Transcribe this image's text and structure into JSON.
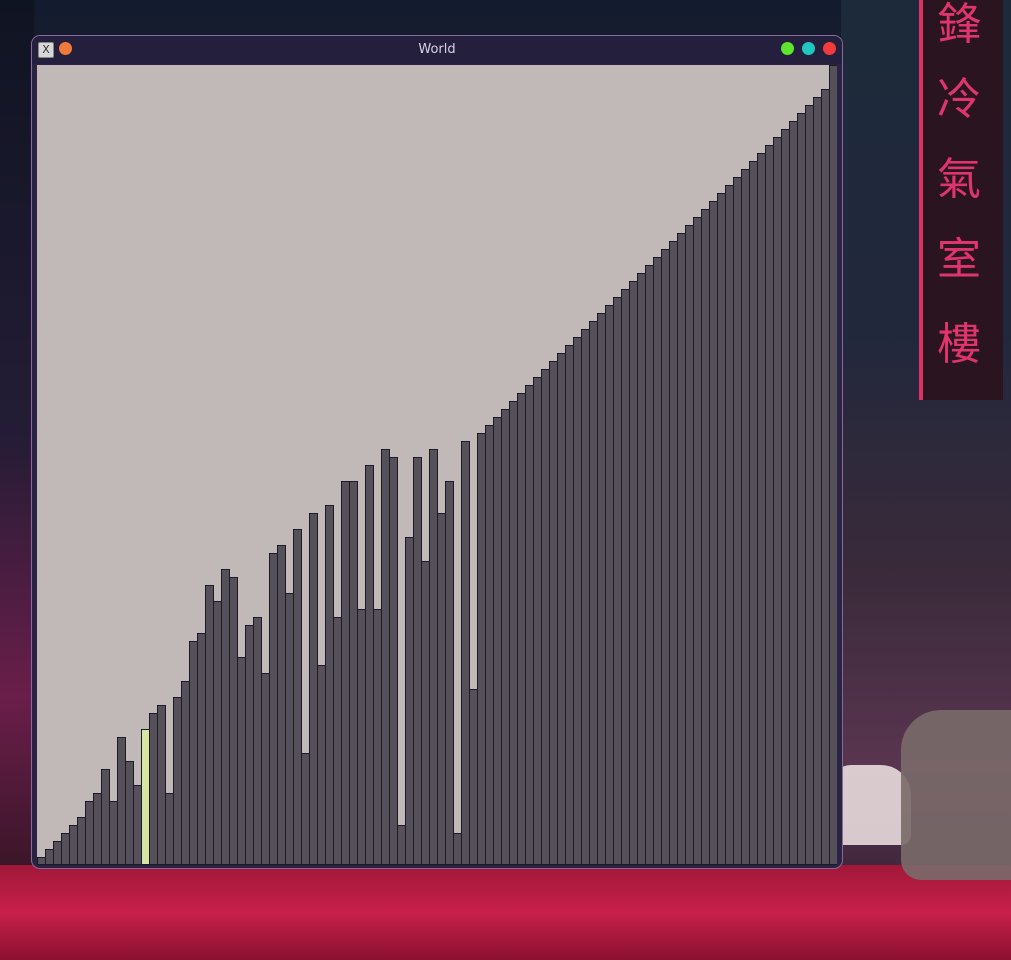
{
  "window": {
    "title": "World",
    "app_icon_glyph": "X"
  },
  "desktop": {
    "sign_glyphs": [
      "鋒",
      "冷",
      "氣",
      "室",
      "樓"
    ]
  },
  "colors": {
    "bar_fill": "#55505a",
    "bar_highlight": "#d7e5a4",
    "bar_border": "#1c1a22",
    "canvas_background": "#c1b9b8"
  },
  "visualization": {
    "type": "sorting-bars",
    "bar_count": 100,
    "max_value": 100,
    "highlighted_indices": [
      13
    ],
    "values": [
      1,
      2,
      3,
      4,
      5,
      6,
      8,
      9,
      12,
      8,
      16,
      13,
      10,
      17,
      19,
      20,
      9,
      21,
      23,
      28,
      29,
      35,
      33,
      37,
      36,
      26,
      30,
      31,
      24,
      39,
      40,
      34,
      42,
      14,
      44,
      25,
      45,
      31,
      48,
      48,
      32,
      50,
      32,
      52,
      51,
      5,
      41,
      51,
      38,
      52,
      44,
      48,
      4,
      53,
      22,
      54,
      55,
      56,
      57,
      58,
      59,
      60,
      61,
      62,
      63,
      64,
      65,
      66,
      67,
      68,
      69,
      70,
      71,
      72,
      73,
      74,
      75,
      76,
      77,
      78,
      79,
      80,
      81,
      82,
      83,
      84,
      85,
      86,
      87,
      88,
      89,
      90,
      91,
      92,
      93,
      94,
      95,
      96,
      97,
      100
    ]
  }
}
